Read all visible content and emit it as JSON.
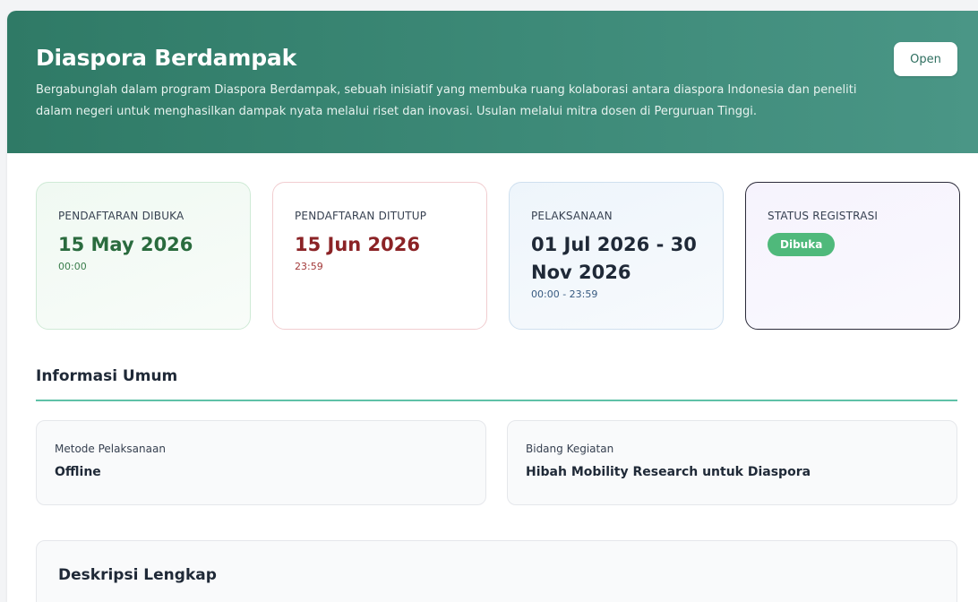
{
  "hero": {
    "title": "Diaspora Berdampak",
    "description": "Bergabunglah dalam program Diaspora Berdampak, sebuah inisiatif yang membuka ruang kolaborasi antara diaspora Indonesia dan peneliti dalam negeri untuk menghasilkan dampak nyata melalui riset dan inovasi. Usulan melalui mitra dosen di Perguruan Tinggi.",
    "open_label": "Open"
  },
  "cards": {
    "registration_open": {
      "label": "PENDAFTARAN DIBUKA",
      "date": "15 May 2026",
      "time": "00:00"
    },
    "registration_close": {
      "label": "PENDAFTARAN DITUTUP",
      "date": "15 Jun 2026",
      "time": "23:59"
    },
    "execution": {
      "label": "PELAKSANAAN",
      "date": "01 Jul 2026 - 30 Nov 2026",
      "time": "00:00 - 23:59"
    },
    "status": {
      "label": "STATUS REGISTRASI",
      "badge": "Dibuka"
    }
  },
  "general_info": {
    "title": "Informasi Umum",
    "method": {
      "label": "Metode Pelaksanaan",
      "value": "Offline"
    },
    "field": {
      "label": "Bidang Kegiatan",
      "value": "Hibah Mobility Research untuk Diaspora"
    }
  },
  "full_description": {
    "title": "Deskripsi Lengkap"
  },
  "colors": {
    "hero_bg": "#3d8a78",
    "accent_green": "#4fb97b",
    "open_date": "#2a6b3e",
    "close_date": "#8b2326",
    "section_rule": "#5fc1a7"
  }
}
